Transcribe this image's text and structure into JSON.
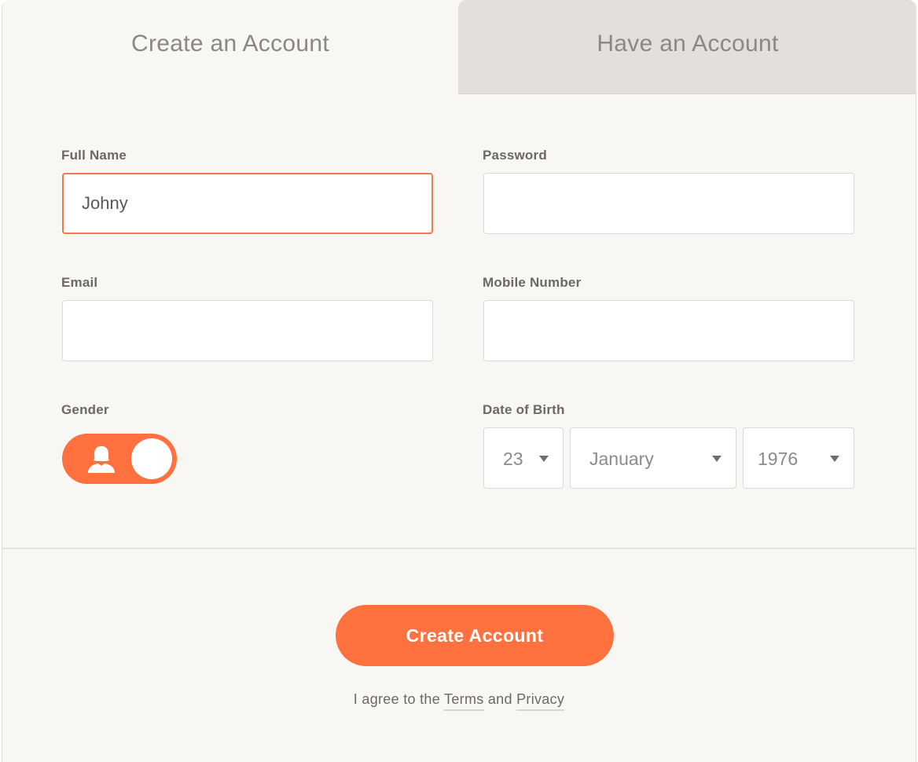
{
  "tabs": {
    "create": "Create an Account",
    "have": "Have an Account"
  },
  "form": {
    "full_name": {
      "label": "Full Name",
      "value": "Johny"
    },
    "password": {
      "label": "Password",
      "value": ""
    },
    "email": {
      "label": "Email",
      "value": ""
    },
    "mobile": {
      "label": "Mobile Number",
      "value": ""
    },
    "gender": {
      "label": "Gender"
    },
    "dob": {
      "label": "Date of Birth",
      "day": "23",
      "month": "January",
      "year": "1976"
    }
  },
  "submit_label": "Create Account",
  "agree": {
    "prefix": "I agree to the ",
    "terms": "Terms",
    "and": " and ",
    "privacy": "Privacy"
  },
  "colors": {
    "accent": "#ff7240",
    "background": "#f8f7f4",
    "inactive_tab": "#e3e0dc"
  }
}
